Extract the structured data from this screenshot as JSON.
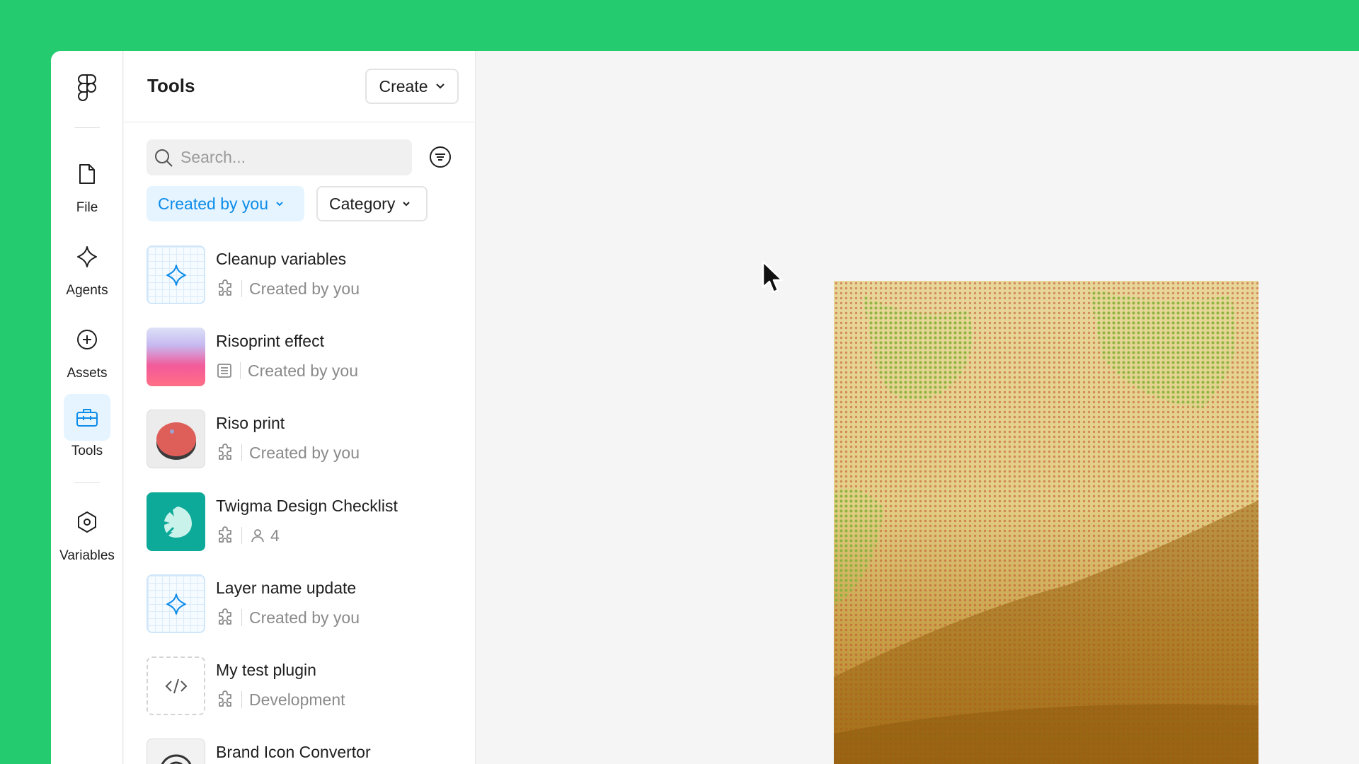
{
  "rail": {
    "items": [
      {
        "label": "File",
        "icon": "file-icon"
      },
      {
        "label": "Agents",
        "icon": "sparkle-icon"
      },
      {
        "label": "Assets",
        "icon": "plus-circle-icon"
      },
      {
        "label": "Tools",
        "icon": "toolbox-icon",
        "active": true
      },
      {
        "label": "Variables",
        "icon": "hexagon-icon"
      }
    ]
  },
  "panel": {
    "title": "Tools",
    "create_label": "Create",
    "search_placeholder": "Search...",
    "filters": {
      "created_by": "Created by you",
      "category": "Category"
    },
    "tools": [
      {
        "name": "Cleanup variables",
        "type_icon": "puzzle-icon",
        "meta": "Created by you"
      },
      {
        "name": "Risoprint effect",
        "type_icon": "widget-icon",
        "meta": "Created by you"
      },
      {
        "name": "Riso print",
        "type_icon": "puzzle-icon",
        "meta": "Created by you"
      },
      {
        "name": "Twigma Design Checklist",
        "type_icon": "puzzle-icon",
        "meta_icon": "user-icon",
        "meta": "4"
      },
      {
        "name": "Layer name update",
        "type_icon": "puzzle-icon",
        "meta": "Created by you"
      },
      {
        "name": "My test plugin",
        "type_icon": "puzzle-icon",
        "meta": "Development"
      },
      {
        "name": "Brand Icon Convertor",
        "type_icon": "puzzle-icon",
        "meta": ""
      }
    ]
  },
  "colors": {
    "background": "#24CB6F",
    "accent_blue": "#0D8CE9",
    "accent_blue_bg": "#E5F4FF",
    "twigma_teal": "#0DA999"
  }
}
